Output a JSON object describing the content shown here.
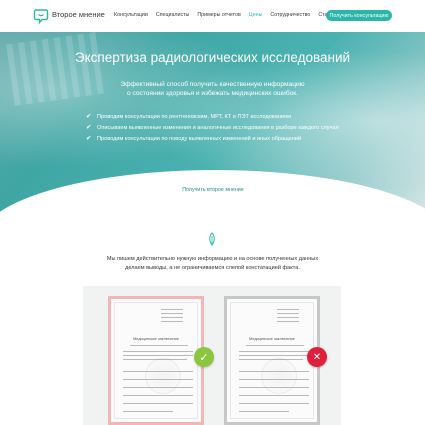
{
  "nav": {
    "logo_icon": "chat-bubble-logo-icon",
    "brand": "Второе мнение",
    "menu": [
      "Консультации",
      "Специалисты",
      "Примеры отчетов",
      "Цены",
      "Сотрудничество",
      "Статьи"
    ],
    "active_menu_index": 3,
    "cta": "Получить консультацию"
  },
  "hero": {
    "title": "Экспертиза радиологических исследований",
    "subtitle_line1": "Эффективный способ получить качественную информацию",
    "subtitle_line2": "о состоянии здоровья и избежать медицинских ошибок.",
    "bullets": [
      "Проводим консультации по рентгеновским, МРТ, КТ и ПЭТ исследованиям",
      "Описываем выявленные изменения и аналогичные исследования в разборе каждого случая",
      "Проводим консультации по поводу выявленных изменений и иных обращений"
    ],
    "button": "Получить второе мнение",
    "accent": "#2bb6a9"
  },
  "intro": {
    "line1": "Мы пишем действительно нужную информацию и на основе полученных данных",
    "line2": "делаем выводы, а не ограничиваемся слепой констатацией факта."
  },
  "documents": {
    "left": {
      "heading": "Медицинское заключение",
      "status_icon": "check-icon",
      "color": "#8cc63f"
    },
    "right": {
      "heading": "Медицинское заключение",
      "status_icon": "close-icon",
      "color": "#e0203a"
    }
  }
}
